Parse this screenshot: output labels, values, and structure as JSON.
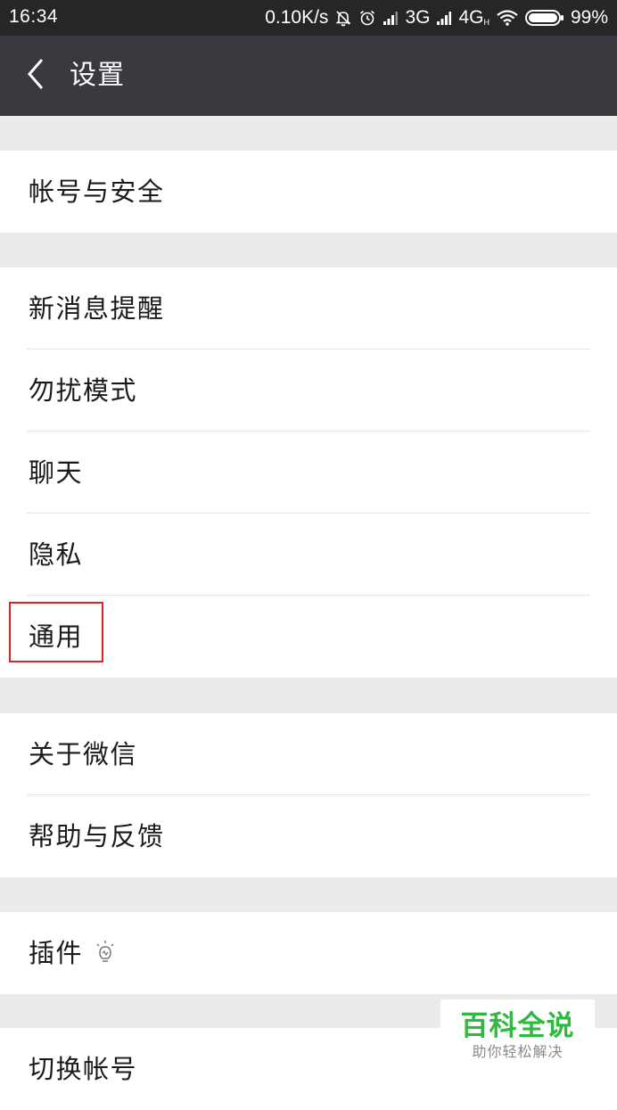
{
  "status_bar": {
    "time": "16:34",
    "net_speed": "0.10K/s",
    "network_1": "3G",
    "network_2": "4G",
    "network_2_sup": "H",
    "battery": "99%",
    "icons": [
      "mute-bell-icon",
      "alarm-icon",
      "signal-icon",
      "signal-icon",
      "wifi-icon",
      "battery-icon"
    ]
  },
  "header": {
    "back_icon": "chevron-left-icon",
    "title": "设置"
  },
  "settings": {
    "account_security": "帐号与安全",
    "new_message_alert": "新消息提醒",
    "do_not_disturb": "勿扰模式",
    "chat": "聊天",
    "privacy": "隐私",
    "general": "通用",
    "about_wechat": "关于微信",
    "help_feedback": "帮助与反馈",
    "plugins": "插件",
    "plugins_icon": "lightbulb-icon",
    "switch_account": "切换帐号"
  },
  "annotation": {
    "highlight_color": "#d6262a",
    "highlighted_item": "通用"
  },
  "watermark": {
    "title": "百科全说",
    "subtitle": "助你轻松解决",
    "title_color": "#30b93f"
  },
  "colors": {
    "status_bar": "#262626",
    "app_bar": "#393a3f",
    "background": "#ebebeb"
  }
}
